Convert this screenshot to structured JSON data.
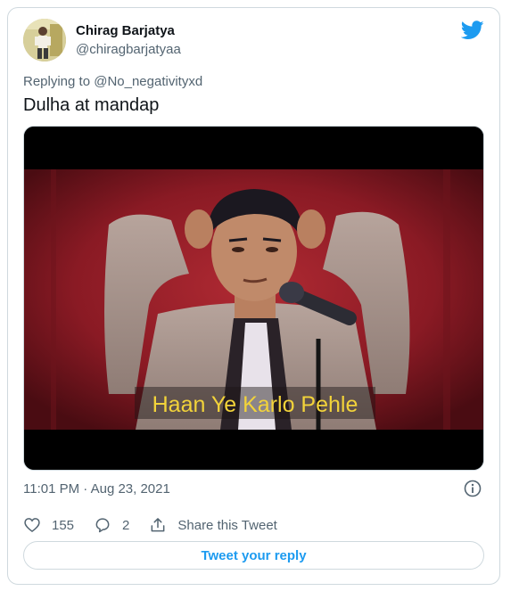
{
  "tweet": {
    "author": {
      "name": "Chirag Barjatya",
      "handle": "@chiragbarjatyaa"
    },
    "replying": {
      "prefix": "Replying to",
      "mention": "@No_negativityxd"
    },
    "text": "Dulha at mandap",
    "media": {
      "caption": "Haan Ye Karlo Pehle"
    },
    "timestamp": "11:01 PM · Aug 23, 2021",
    "likes": "155",
    "replies": "2",
    "share_label": "Share this Tweet",
    "reply_button_label": "Tweet your reply"
  },
  "icons": {
    "brand": "twitter-bird-icon",
    "info": "info-icon",
    "like": "heart-icon",
    "reply": "speech-bubble-icon",
    "share": "share-arrow-icon"
  },
  "colors": {
    "brand_blue": "#1d9bf0",
    "secondary_text": "#536471",
    "border": "#cfd9de",
    "caption_yellow": "#f2d33a"
  }
}
